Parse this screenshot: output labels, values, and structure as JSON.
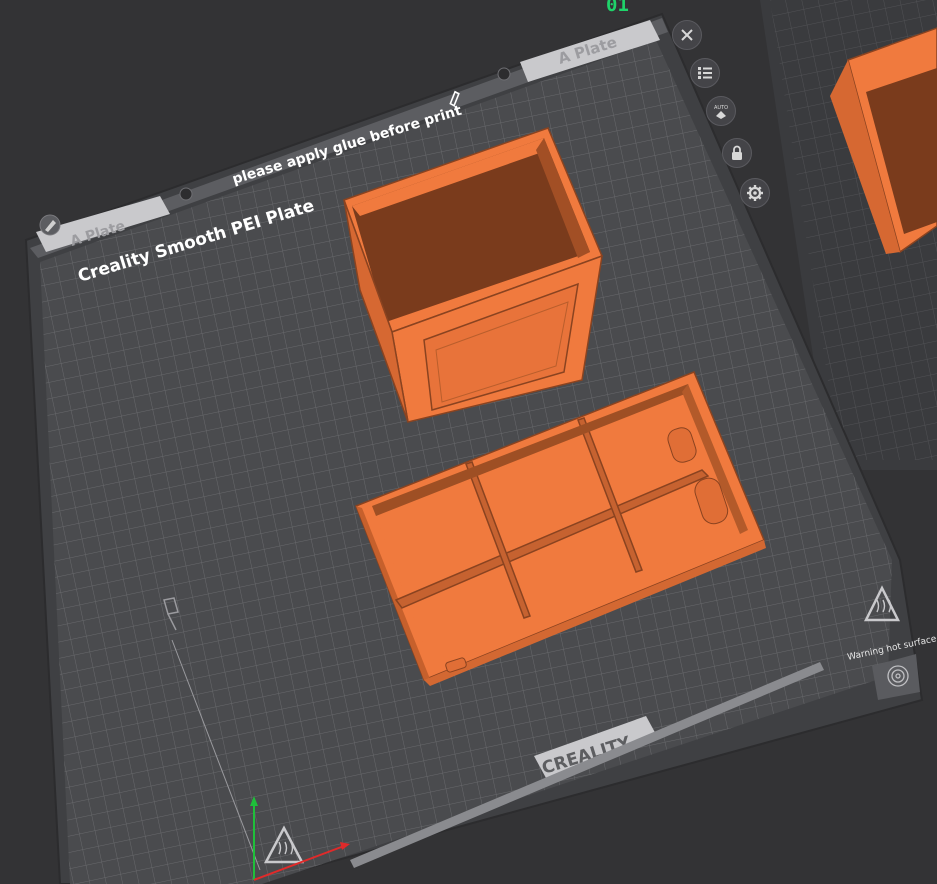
{
  "plate": {
    "index": "01",
    "type_name": "Creality Smooth PEI Plate",
    "notice": "please apply glue before print",
    "tab_left": "A Plate",
    "tab_right": "A Plate",
    "brand": "CREALITY",
    "warning": "Warning hot surface"
  },
  "toolbar": {
    "buttons": [
      {
        "name": "close-plate-button",
        "icon": "close-icon"
      },
      {
        "name": "arrange-button",
        "icon": "arrange-list-icon"
      },
      {
        "name": "auto-orient-button",
        "icon": "auto-orient-icon",
        "label": "AUTO"
      },
      {
        "name": "lock-plate-button",
        "icon": "lock-icon"
      },
      {
        "name": "plate-settings-button",
        "icon": "gear-icon"
      }
    ]
  },
  "colors": {
    "background": "#333335",
    "bed": "#4a4b4e",
    "grid": "#6a6b6e",
    "model": "#f07a3e",
    "model_dark": "#8a4320",
    "accent_green": "#1fd46a"
  }
}
